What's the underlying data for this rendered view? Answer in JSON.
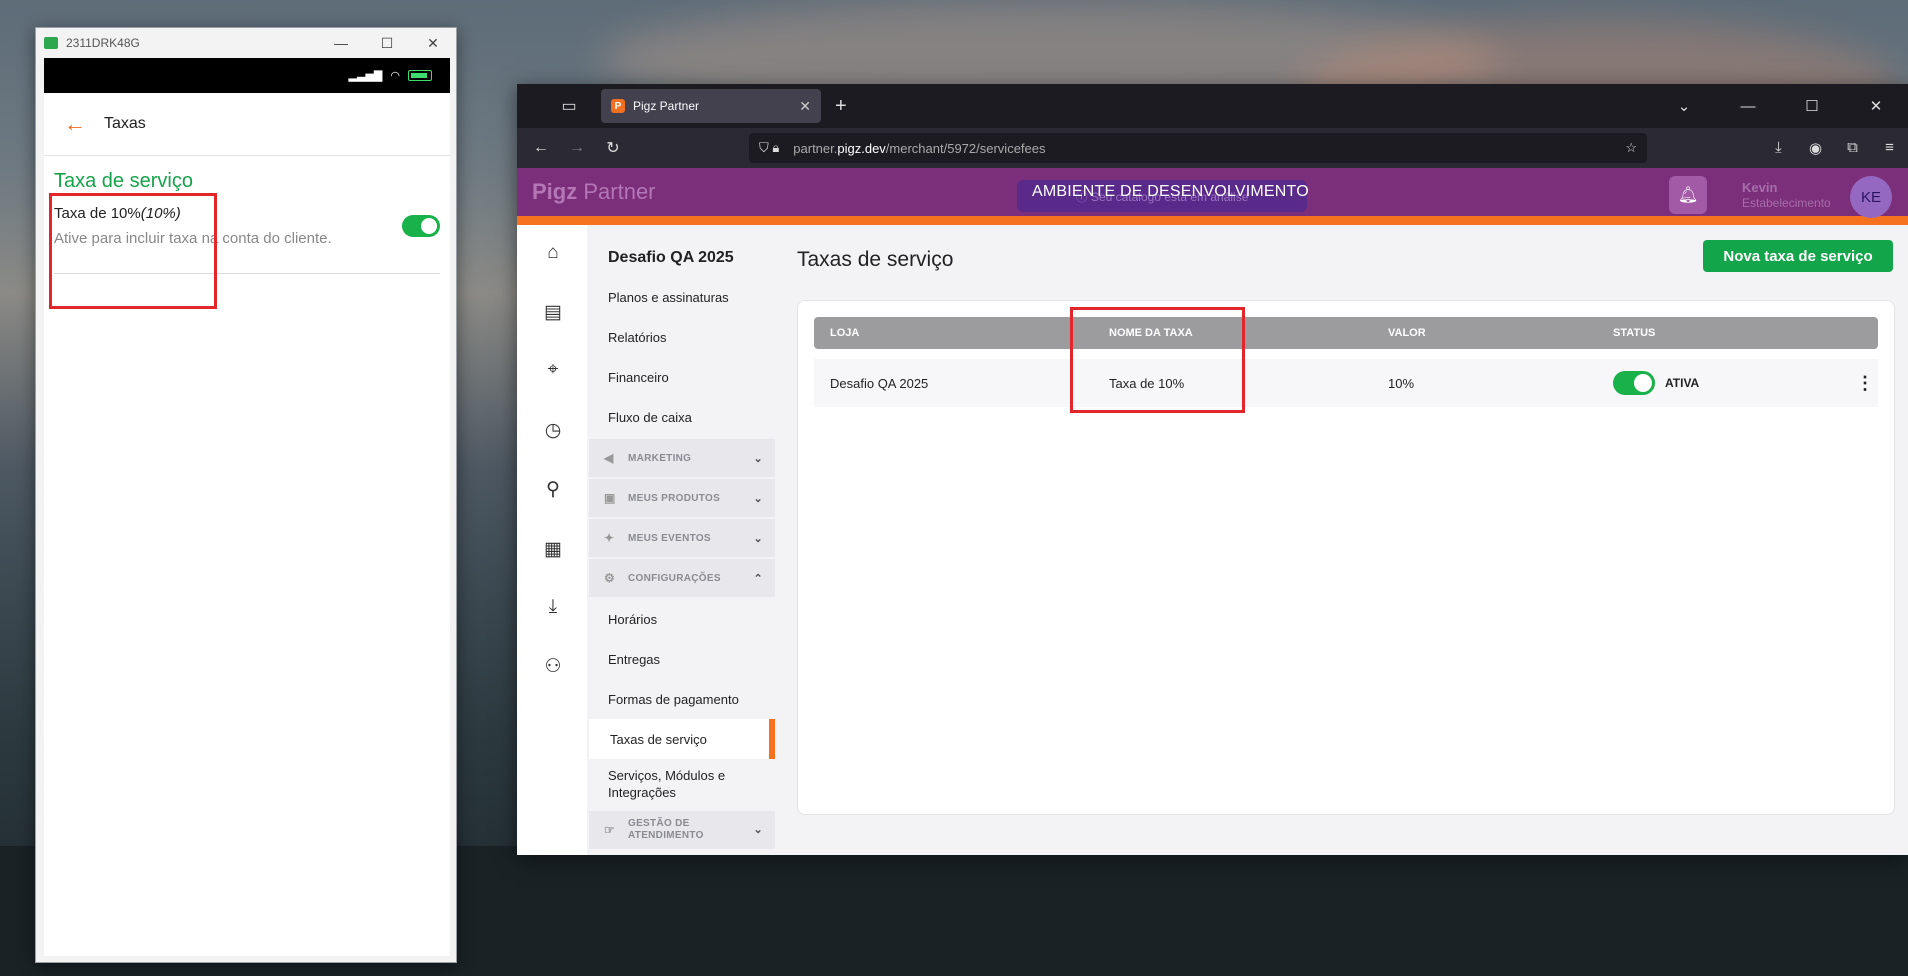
{
  "phone_window": {
    "title": "2311DRK48G",
    "controls": {
      "minimize": "—",
      "maximize": "☐",
      "close": "✕"
    },
    "app": {
      "header_title": "Taxas",
      "section_title": "Taxa de serviço",
      "fee": {
        "name": "Taxa de 10%",
        "name_suffix": "(10%)",
        "description": "Ative para incluir taxa na conta do cliente.",
        "enabled": true
      }
    }
  },
  "browser": {
    "tab_title": "Pigz Partner",
    "favicon_letter": "P",
    "new_tab": "+",
    "url": {
      "prefix": "partner.",
      "domain": "pigz.dev",
      "path": "/merchant/5972/servicefees"
    },
    "window_controls": {
      "list": "⌄",
      "minimize": "—",
      "maximize": "☐",
      "close": "✕"
    }
  },
  "app": {
    "logo_bold": "Pigz",
    "logo_light": "Partner",
    "dev_banner": "AMBIENTE DE DESENVOLVIMENTO",
    "hidden_banner": "ⓘ Seu catálogo está em análise",
    "user_name": "Kevin",
    "user_role": "Estabelecimento",
    "avatar_initials": "KE",
    "menu": {
      "store_name": "Desafio QA 2025",
      "items_top": [
        "Planos e assinaturas",
        "Relatórios",
        "Financeiro",
        "Fluxo de caixa"
      ],
      "groups": [
        "MARKETING",
        "MEUS PRODUTOS",
        "MEUS EVENTOS",
        "CONFIGURAÇÕES"
      ],
      "config_items": [
        "Horários",
        "Entregas",
        "Formas de pagamento",
        "Taxas de serviço",
        "Serviços, Módulos e Integrações"
      ],
      "bottom_group": "GESTÃO DE ATENDIMENTO"
    },
    "page_title": "Taxas de serviço",
    "new_button": "Nova taxa de serviço",
    "table": {
      "headers": [
        "LOJA",
        "NOME DA TAXA",
        "VALOR",
        "STATUS"
      ],
      "rows": [
        {
          "store": "Desafio QA 2025",
          "fee_name": "Taxa de 10%",
          "value": "10%",
          "status": "ATIVA",
          "active": true
        }
      ]
    }
  },
  "colors": {
    "accent_green": "#13a54a",
    "brand_purple": "#7b2e7a",
    "brand_orange": "#f7721e",
    "highlight_red": "#e3262b"
  }
}
